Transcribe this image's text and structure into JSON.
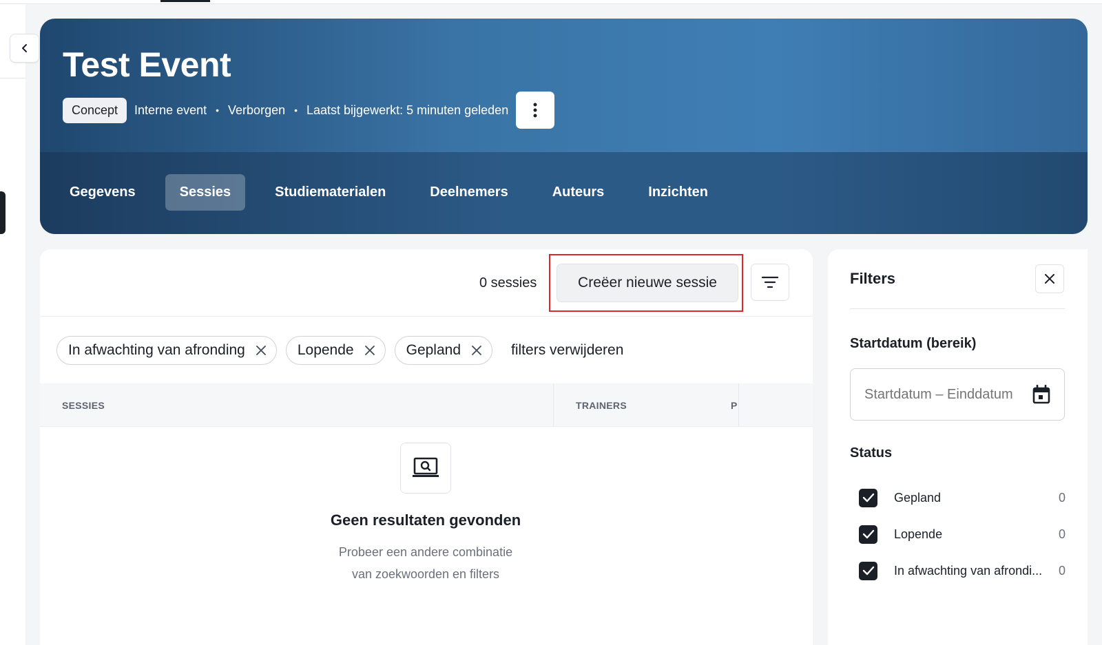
{
  "event": {
    "title": "Test Event",
    "status_badge": "Concept",
    "meta": [
      "Interne event",
      "Verborgen",
      "Laatst bijgewerkt: 5 minuten geleden"
    ]
  },
  "tabs": [
    {
      "label": "Gegevens",
      "active": false
    },
    {
      "label": "Sessies",
      "active": true
    },
    {
      "label": "Studiematerialen",
      "active": false
    },
    {
      "label": "Deelnemers",
      "active": false
    },
    {
      "label": "Auteurs",
      "active": false
    },
    {
      "label": "Inzichten",
      "active": false
    }
  ],
  "toolbar": {
    "count": "0 sessies",
    "create_label": "Creëer nieuwe sessie"
  },
  "chips": [
    "In afwachting van afronding",
    "Lopende",
    "Gepland"
  ],
  "clear_filters": "filters verwijderen",
  "table": {
    "headers": [
      "SESSIES",
      "TRAINERS",
      "P"
    ]
  },
  "empty": {
    "title": "Geen resultaten gevonden",
    "line1": "Probeer een andere combinatie",
    "line2": "van zoekwoorden en filters"
  },
  "filters_panel": {
    "title": "Filters",
    "date_section": "Startdatum (bereik)",
    "date_placeholder": "Startdatum – Einddatum",
    "status_section": "Status",
    "statuses": [
      {
        "label": "Gepland",
        "count": "0",
        "checked": true
      },
      {
        "label": "Lopende",
        "count": "0",
        "checked": true
      },
      {
        "label": "In afwachting van afrondi...",
        "count": "0",
        "checked": true
      }
    ]
  },
  "colors": {
    "accent_dark": "#1b1f27",
    "hero_blue": "#3a74a6",
    "highlight": "#e0262a"
  }
}
